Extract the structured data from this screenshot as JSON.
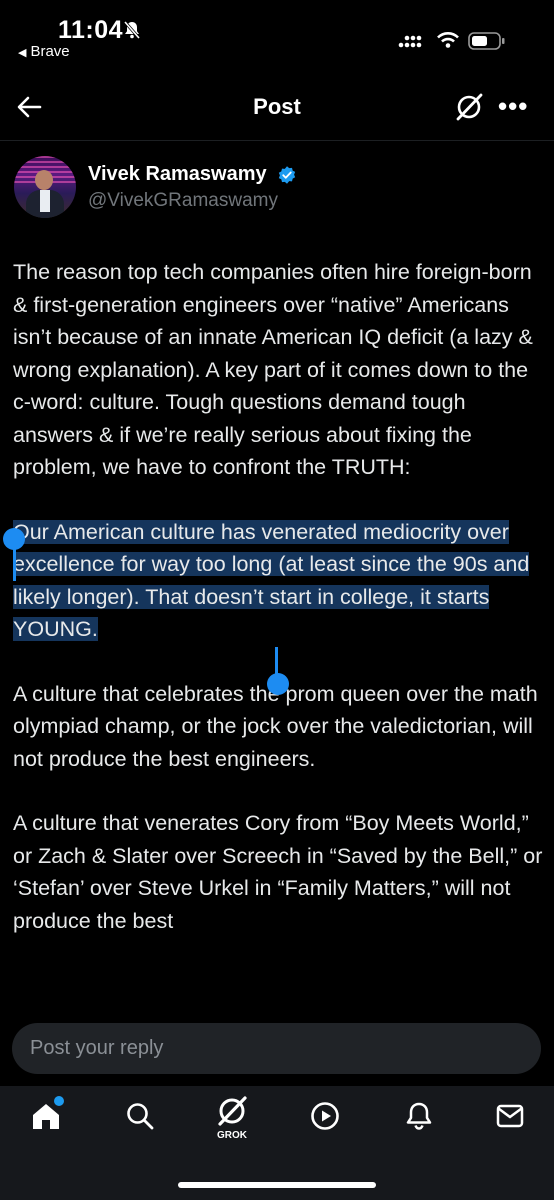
{
  "status_bar": {
    "time": "11:04",
    "back_app": "Brave"
  },
  "header": {
    "title": "Post"
  },
  "post": {
    "author_name": "Vivek Ramaswamy",
    "author_handle": "@VivekGRamaswamy",
    "paragraph_1": "The reason top tech companies often hire foreign-born & first-generation engineers over “native” Americans isn’t because of an innate American IQ deficit (a lazy & wrong explanation). A key part of it comes down to the c-word: culture. Tough questions demand tough answers & if we’re really serious about fixing the problem, we have to confront the TRUTH:",
    "paragraph_2_selected": "Our American culture has venerated mediocrity over excellence for way too long (at least since the 90s and likely longer). That doesn’t start in college, it starts YOUNG.",
    "paragraph_3": "A culture that celebrates the prom queen over the math olympiad champ, or the jock over the valedictorian, will not produce the best engineers.",
    "paragraph_4": "A culture that venerates Cory from “Boy Meets World,” or Zach & Slater over Screech in “Saved by the Bell,” or ‘Stefan’ over Steve Urkel in “Family Matters,” will not produce the best"
  },
  "reply": {
    "placeholder": "Post your reply"
  },
  "tab_bar": {
    "items": [
      "home-icon",
      "search-icon",
      "grok-icon",
      "video-icon",
      "notifications-icon",
      "messages-icon"
    ],
    "grok_label": "GROK"
  },
  "colors": {
    "accent": "#1d9bf0",
    "selection": "#15355c",
    "muted": "#71767b"
  }
}
